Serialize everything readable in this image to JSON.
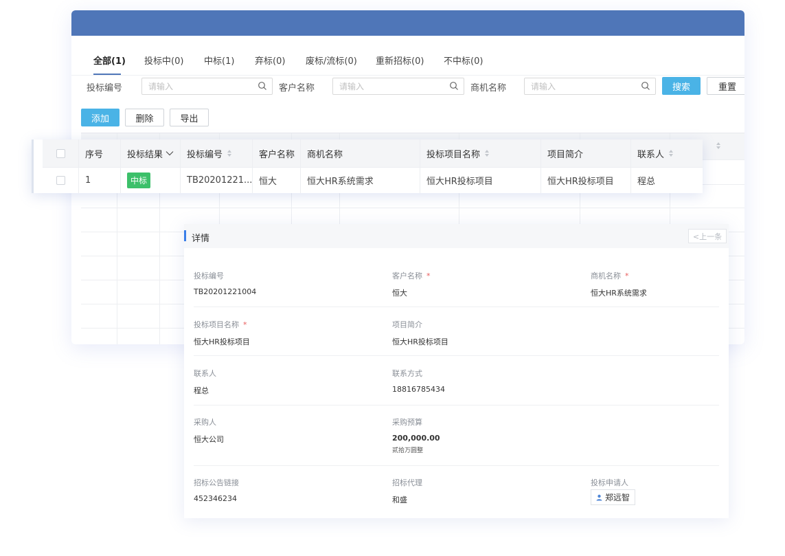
{
  "tabs": [
    {
      "label": "全部(1)"
    },
    {
      "label": "投标中(0)"
    },
    {
      "label": "中标(1)"
    },
    {
      "label": "弃标(0)"
    },
    {
      "label": "废标/流标(0)"
    },
    {
      "label": "重新招标(0)"
    },
    {
      "label": "不中标(0)"
    }
  ],
  "filters": {
    "bid_no_label": "投标编号",
    "customer_label": "客户名称",
    "opportunity_label": "商机名称",
    "placeholder": "请输入",
    "search_label": "搜索",
    "reset_label": "重置"
  },
  "actions": {
    "add": "添加",
    "delete": "删除",
    "export": "导出"
  },
  "table": {
    "headers": [
      "序号",
      "投标结果",
      "投标编号",
      "客户名称",
      "商机名称",
      "投标项目名称",
      "项目简介",
      "联系人"
    ],
    "row": {
      "index": "1",
      "result": "中标",
      "bid_no": "TB20201221...",
      "customer": "恒大",
      "opportunity": "恒大HR系统需求",
      "project": "恒大HR投标项目",
      "summary": "恒大HR投标项目",
      "contact": "程总"
    }
  },
  "detail": {
    "title": "详情",
    "prev_label": "<上一条",
    "required_mark": "*",
    "fields": {
      "bid_no": {
        "label": "投标编号",
        "value": "TB20201221004"
      },
      "customer": {
        "label": "客户名称",
        "value": "恒大"
      },
      "opportunity": {
        "label": "商机名称",
        "value": "恒大HR系统需求"
      },
      "project": {
        "label": "投标项目名称",
        "value": "恒大HR投标项目"
      },
      "summary": {
        "label": "项目简介",
        "value": "恒大HR投标项目"
      },
      "contact": {
        "label": "联系人",
        "value": "程总"
      },
      "phone": {
        "label": "联系方式",
        "value": "18816785434"
      },
      "purchaser": {
        "label": "采购人",
        "value": "恒大公司"
      },
      "budget": {
        "label": "采购预算",
        "value": "200,000.00",
        "uppercase": "贰拾万圆整"
      },
      "notice_link": {
        "label": "招标公告链接",
        "value": "452346234"
      },
      "agent": {
        "label": "招标代理",
        "value": "和盛"
      },
      "applicant": {
        "label": "投标申请人",
        "value": "郑远智"
      }
    }
  },
  "colors": {
    "header": "#4f76b8",
    "primary": "#4ab3e6",
    "success": "#3cc06a",
    "accent": "#3a7ee8",
    "required": "#e85b5b"
  }
}
